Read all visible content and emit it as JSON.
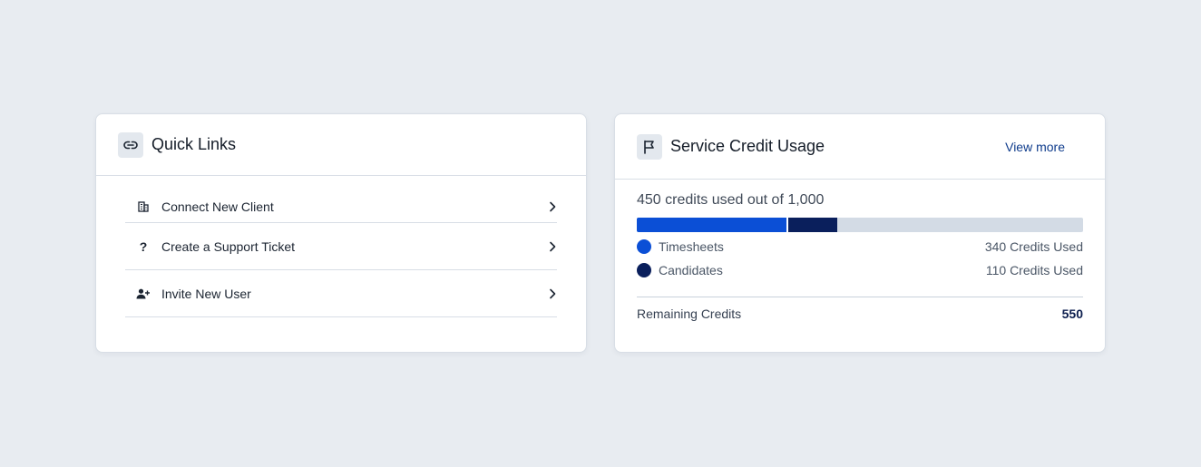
{
  "quick_links": {
    "title": "Quick Links",
    "items": [
      {
        "label": "Connect New Client",
        "icon": "building-icon"
      },
      {
        "label": "Create a Support Ticket",
        "icon": "question-icon"
      },
      {
        "label": "Invite New User",
        "icon": "user-plus-icon"
      }
    ]
  },
  "credit_usage": {
    "title": "Service Credit Usage",
    "view_more": "View more",
    "summary": "450 credits used out of 1,000",
    "total": 1000,
    "series": [
      {
        "name": "Timesheets",
        "value_label": "340 Credits Used",
        "value": 340,
        "color": "#0b4fd6"
      },
      {
        "name": "Candidates",
        "value_label": "110 Credits Used",
        "value": 110,
        "color": "#0a1f5c"
      }
    ],
    "track_color": "#d3dbe5",
    "remaining_label": "Remaining Credits",
    "remaining_value": "550"
  }
}
